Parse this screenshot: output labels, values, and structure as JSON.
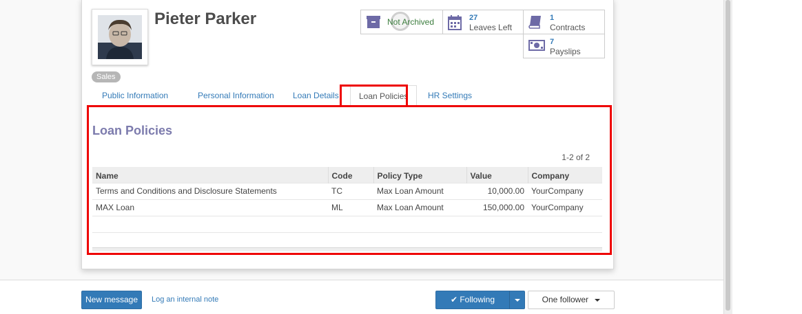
{
  "employee": {
    "name": "Pieter Parker",
    "tag": "Sales"
  },
  "stats": {
    "archived_label": "Not Archived",
    "leaves_count": "27",
    "leaves_label": "Leaves Left",
    "contracts_count": "1",
    "contracts_label": "Contracts",
    "payslips_count": "7",
    "payslips_label": "Payslips"
  },
  "tabs": [
    {
      "label": "Public Information"
    },
    {
      "label": "Personal Information"
    },
    {
      "label": "Loan Details"
    },
    {
      "label": "Loan Policies"
    },
    {
      "label": "HR Settings"
    }
  ],
  "active_tab": "Loan Policies",
  "section": {
    "title": "Loan Policies",
    "pager": "1-2 of 2"
  },
  "table": {
    "headers": [
      "Name",
      "Code",
      "Policy Type",
      "Value",
      "Company"
    ],
    "rows": [
      {
        "name": "Terms and Conditions and Disclosure Statements",
        "code": "TC",
        "policy_type": "Max Loan Amount",
        "value": "10,000.00",
        "company": "YourCompany"
      },
      {
        "name": "MAX Loan",
        "code": "ML",
        "policy_type": "Max Loan Amount",
        "value": "150,000.00",
        "company": "YourCompany"
      }
    ]
  },
  "chatter": {
    "new_message": "New message",
    "log_note": "Log an internal note",
    "following": "✔ Following",
    "followers": "One follower"
  },
  "colors": {
    "link": "#337ab7",
    "primary": "#337ab7",
    "section_title": "#7c7bad",
    "highlight": "#ee0000",
    "archived_text": "#3c7d3e"
  },
  "icons": [
    "archive-icon",
    "calendar-icon",
    "book-icon",
    "money-icon",
    "checkmark-icon",
    "caret-down-icon"
  ]
}
